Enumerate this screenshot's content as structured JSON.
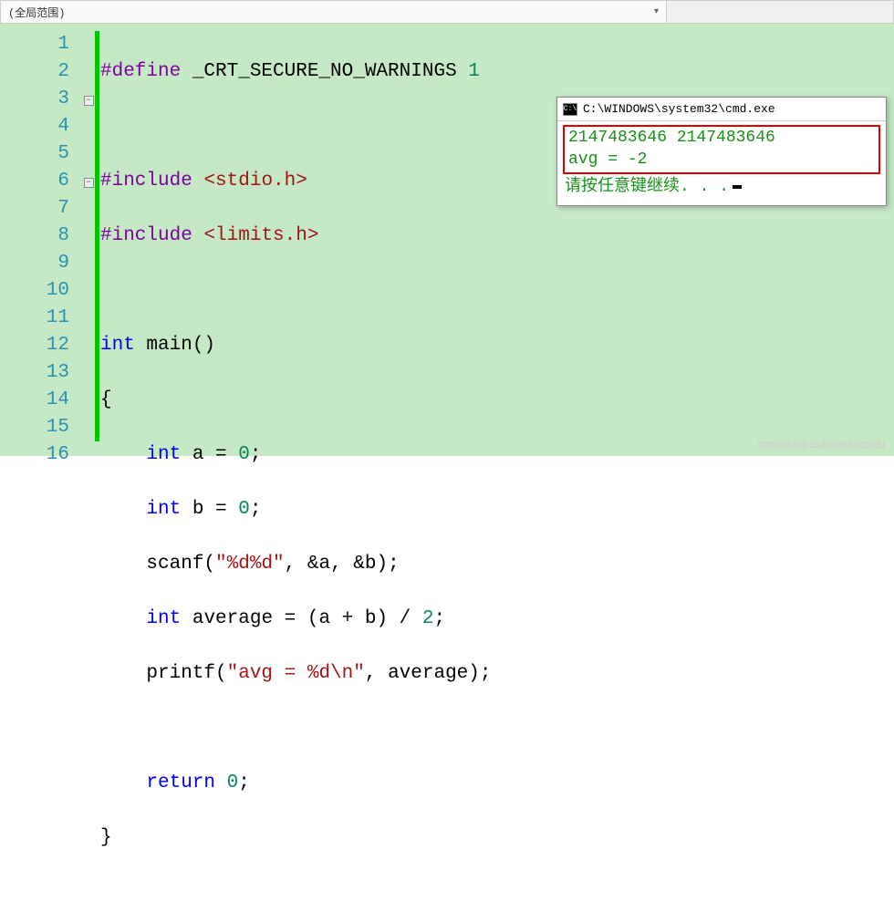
{
  "toolbar": {
    "scope_label": "(全局范围)"
  },
  "lines": {
    "l1_define": "#define",
    "l1_macro": " _CRT_SECURE_NO_WARNINGS ",
    "l1_val": "1",
    "l3_include": "#include",
    "l3_hdr": "<stdio.h>",
    "l4_include": "#include",
    "l4_hdr": "<limits.h>",
    "l6_int": "int",
    "l6_main": " main()",
    "l7_brace": "{",
    "l8_int": "int",
    "l8_rest": " a = ",
    "l8_zero": "0",
    "l8_semi": ";",
    "l9_int": "int",
    "l9_rest": " b = ",
    "l9_zero": "0",
    "l9_semi": ";",
    "l10_scanf": "    scanf(",
    "l10_fmt": "\"%d%d\"",
    "l10_args": ", &a, &b);",
    "l11_int": "int",
    "l11_rest": " average = (a + b) / ",
    "l11_two": "2",
    "l11_semi": ";",
    "l12_printf": "    printf(",
    "l12_fmt": "\"avg = %d\\n\"",
    "l12_args": ", average);",
    "l14_return": "return",
    "l14_val": " ",
    "l14_zero": "0",
    "l14_semi": ";",
    "l15_brace": "}"
  },
  "line_numbers": [
    "1",
    "2",
    "3",
    "4",
    "5",
    "6",
    "7",
    "8",
    "9",
    "10",
    "11",
    "12",
    "13",
    "14",
    "15",
    "16"
  ],
  "cmd": {
    "title": "C:\\WINDOWS\\system32\\cmd.exe",
    "icon_text": "C:\\",
    "line1": "2147483646 2147483646",
    "line2": "avg = -2",
    "line3": "请按任意键继续. . ."
  },
  "watermark": "https://blog.csdn.net/bitzhidu"
}
